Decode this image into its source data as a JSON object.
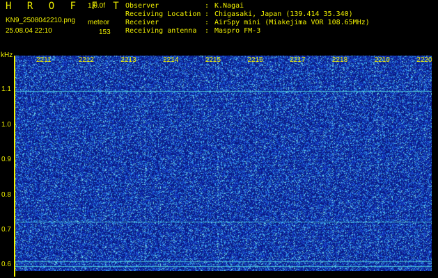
{
  "header": {
    "app_title": "H R O F F T",
    "version": "1.0.0f",
    "filename": "KN9_2508042210.png",
    "datetime": "25.08.04 22:10",
    "mode_label": "meteor",
    "count": "153"
  },
  "metadata": [
    {
      "key": "Observer",
      "sep": ":",
      "value": "K.Nagai"
    },
    {
      "key": "Receiving Location",
      "sep": ":",
      "value": "Chigasaki, Japan (139.414 35.340)"
    },
    {
      "key": "Receiver",
      "sep": ":",
      "value": "AirSpy mini (Miakejima VOR 108.65MHz)"
    },
    {
      "key": "Receiving antenna",
      "sep": ":",
      "value": "Maspro FM-3"
    }
  ],
  "plot": {
    "unit": "kHz",
    "freq_labels": [
      "1.1",
      "1.0",
      "0.9",
      "0.8",
      "0.7",
      "0.6"
    ],
    "freq_values": [
      1.1,
      1.0,
      0.9,
      0.8,
      0.7,
      0.6
    ],
    "freq_range": [
      0.585,
      1.2
    ],
    "time_labels": [
      "2211",
      "2212",
      "2213",
      "2214",
      "2215",
      "2216",
      "2217",
      "2218",
      "2219",
      "2220"
    ],
    "steady_lines_khz": [
      1.098,
      0.725,
      0.612,
      0.598
    ],
    "colors": {
      "text": "#f0f000",
      "background_dark": "#0a1a8a",
      "background_mid": "#1e48c8",
      "speckle": "#46b4ff",
      "line": "#50d2dc"
    }
  }
}
